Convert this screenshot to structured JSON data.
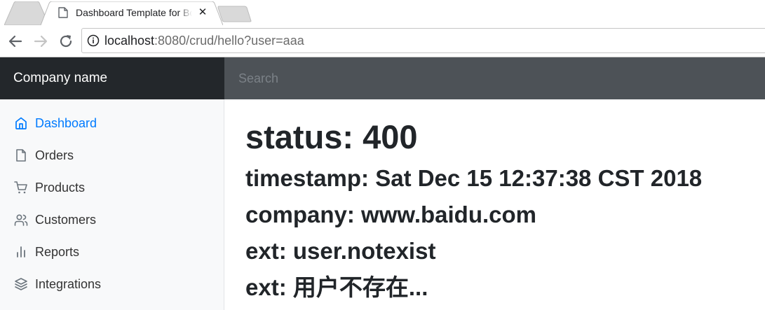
{
  "browser": {
    "tab": {
      "title": "Dashboard Template for Bootstrap",
      "close_glyph": "✕"
    },
    "address": {
      "host": "localhost",
      "rest": ":8080/crud/hello?user=aaa"
    }
  },
  "navbar": {
    "brand": "Company name",
    "search_placeholder": "Search"
  },
  "sidebar": {
    "items": [
      {
        "label": "Dashboard",
        "icon": "home-icon",
        "active": true
      },
      {
        "label": "Orders",
        "icon": "file-icon"
      },
      {
        "label": "Products",
        "icon": "shopping-cart-icon"
      },
      {
        "label": "Customers",
        "icon": "users-icon"
      },
      {
        "label": "Reports",
        "icon": "bar-chart-icon"
      },
      {
        "label": "Integrations",
        "icon": "layers-icon"
      }
    ]
  },
  "main": {
    "status": "status: 400",
    "timestamp": "timestamp: Sat Dec 15 12:37:38 CST 2018",
    "company": "company: www.baidu.com",
    "ext1": "ext: user.notexist",
    "ext2": "ext: 用户不存在..."
  },
  "colors": {
    "brand_bg": "#23272b",
    "search_bg": "#4d5257",
    "sidebar_bg": "#f8f9fa",
    "active_link": "#007bff",
    "text": "#212529"
  }
}
